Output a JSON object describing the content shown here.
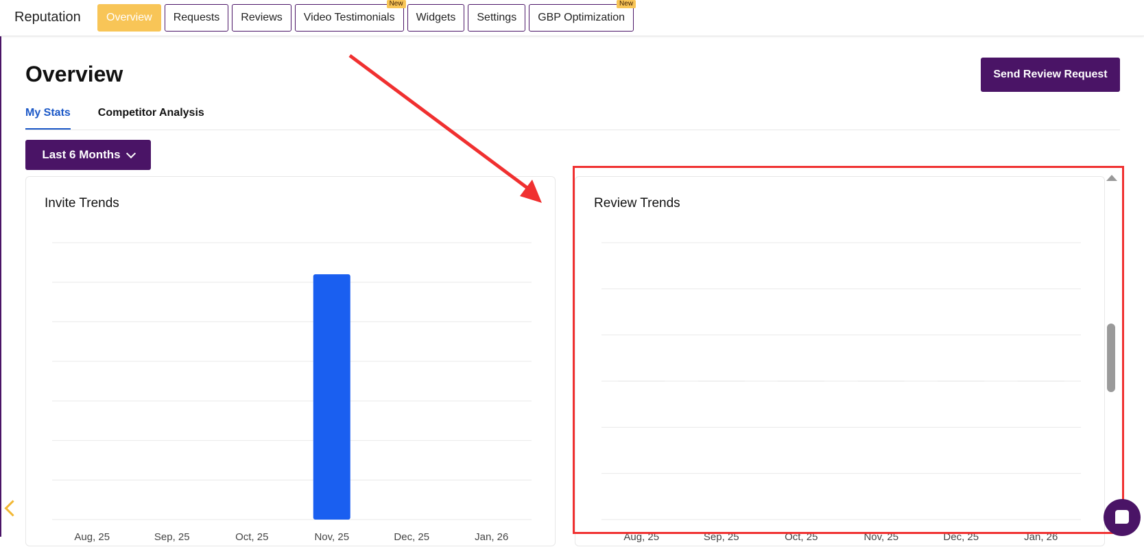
{
  "app": {
    "title": "Reputation"
  },
  "nav": {
    "items": [
      {
        "label": "Overview",
        "active": true,
        "badge": ""
      },
      {
        "label": "Requests",
        "active": false,
        "badge": ""
      },
      {
        "label": "Reviews",
        "active": false,
        "badge": ""
      },
      {
        "label": "Video Testimonials",
        "active": false,
        "badge": "New"
      },
      {
        "label": "Widgets",
        "active": false,
        "badge": ""
      },
      {
        "label": "Settings",
        "active": false,
        "badge": ""
      },
      {
        "label": "GBP Optimization",
        "active": false,
        "badge": "New"
      }
    ]
  },
  "header": {
    "title": "Overview",
    "send_button": "Send Review Request"
  },
  "tabs": [
    {
      "label": "My Stats",
      "active": true
    },
    {
      "label": "Competitor Analysis",
      "active": false
    }
  ],
  "filter": {
    "range_label": "Last 6 Months"
  },
  "colors": {
    "accent_purple": "#4a1466",
    "accent_yellow": "#f8c557",
    "bar_blue": "#1a5ff0",
    "annotation_red": "#f03030"
  },
  "icons": {
    "chevron": "chevron-down-icon",
    "chat": "chat-icon",
    "back": "chevron-left-icon"
  },
  "chart_data": [
    {
      "type": "bar",
      "title": "Invite Trends",
      "categories": [
        "Aug, 25",
        "Sep, 25",
        "Oct, 25",
        "Nov, 25",
        "Dec, 25",
        "Jan, 26"
      ],
      "values": [
        0,
        0,
        0,
        6.2,
        0,
        0
      ],
      "ylim": [
        0,
        7
      ],
      "grid": true
    },
    {
      "type": "line",
      "title": "Review Trends",
      "categories": [
        "Aug, 25",
        "Sep, 25",
        "Oct, 25",
        "Nov, 25",
        "Dec, 25",
        "Jan, 26"
      ],
      "values": [
        0,
        0,
        0,
        0,
        0,
        0
      ],
      "ylim": [
        -1,
        1
      ],
      "grid": true
    }
  ]
}
